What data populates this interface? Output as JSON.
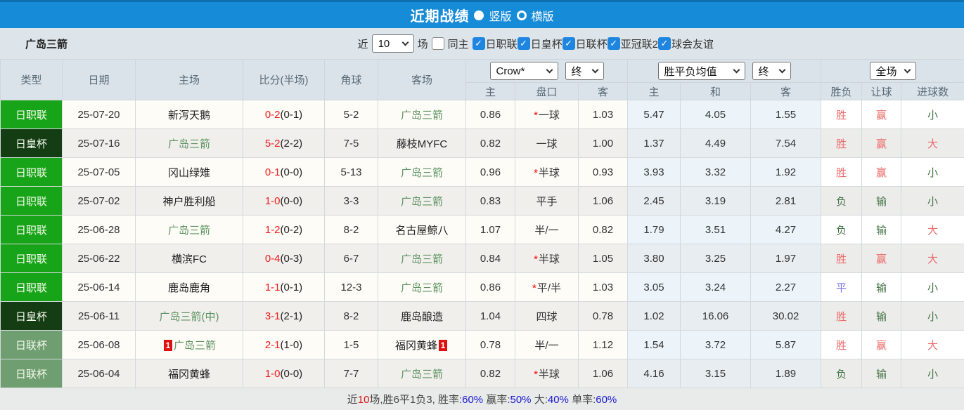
{
  "colors": {
    "title_bar_bg": "#168bd7",
    "team_green": "#5d9361",
    "score_red": "#f21c1c",
    "league": {
      "日职联": "#18a418",
      "日皇杯": "#143d14",
      "日联杯": "#6f9e70"
    },
    "result": {
      "red": "#ec6b6a",
      "green": "#477547",
      "blue": "#7575f0"
    },
    "summary": {
      "dark": "#444444",
      "red": "#dd1111",
      "blue": "#1919cf"
    }
  },
  "title_bar": {
    "title": "近期战绩",
    "options": [
      {
        "label": "竖版",
        "selected": true
      },
      {
        "label": "横版",
        "selected": false
      }
    ]
  },
  "filter_bar": {
    "team": "广岛三箭",
    "recent_prefix": "近",
    "recent_value": "10",
    "recent_suffix": "场",
    "same_home": {
      "label": "同主",
      "checked": false
    },
    "leagues": [
      {
        "label": "日职联",
        "checked": true
      },
      {
        "label": "日皇杯",
        "checked": true
      },
      {
        "label": "日联杯",
        "checked": true
      },
      {
        "label": "亚冠联2",
        "checked": true
      },
      {
        "label": "球会友谊",
        "checked": true
      }
    ]
  },
  "table": {
    "main_headers": [
      "类型",
      "日期",
      "主场",
      "比分(半场)",
      "角球",
      "客场"
    ],
    "selects": {
      "company": "Crow*",
      "company_time": "终",
      "avg": "胜平负均值",
      "avg_time": "终",
      "period": "全场"
    },
    "sub_headers": [
      "主",
      "盘口",
      "客",
      "主",
      "和",
      "客",
      "胜负",
      "让球",
      "进球数"
    ],
    "rows": [
      {
        "league": "日职联",
        "date": "25-07-20",
        "home": {
          "name": "新泻天鹅",
          "green": false
        },
        "score_ft": "0-2",
        "score_ht": "(0-1)",
        "corners": "5-2",
        "away": {
          "name": "广岛三箭",
          "green": true
        },
        "odds_home": "0.86",
        "handicap": "一球",
        "handicap_star": true,
        "odds_away": "1.03",
        "avg_home": "5.47",
        "avg_draw": "4.05",
        "avg_away": "1.55",
        "result_wdl": {
          "text": "胜",
          "color": "red"
        },
        "result_handicap": {
          "text": "赢",
          "color": "red"
        },
        "result_goals": {
          "text": "小",
          "color": "green"
        }
      },
      {
        "league": "日皇杯",
        "date": "25-07-16",
        "home": {
          "name": "广岛三箭",
          "green": true
        },
        "score_ft": "5-2",
        "score_ht": "(2-2)",
        "corners": "7-5",
        "away": {
          "name": "藤枝MYFC",
          "green": false
        },
        "odds_home": "0.82",
        "handicap": "一球",
        "handicap_star": false,
        "odds_away": "1.00",
        "avg_home": "1.37",
        "avg_draw": "4.49",
        "avg_away": "7.54",
        "result_wdl": {
          "text": "胜",
          "color": "red"
        },
        "result_handicap": {
          "text": "赢",
          "color": "red"
        },
        "result_goals": {
          "text": "大",
          "color": "red"
        }
      },
      {
        "league": "日职联",
        "date": "25-07-05",
        "home": {
          "name": "冈山绿雉",
          "green": false
        },
        "score_ft": "0-1",
        "score_ht": "(0-0)",
        "corners": "5-13",
        "away": {
          "name": "广岛三箭",
          "green": true
        },
        "odds_home": "0.96",
        "handicap": "半球",
        "handicap_star": true,
        "odds_away": "0.93",
        "avg_home": "3.93",
        "avg_draw": "3.32",
        "avg_away": "1.92",
        "result_wdl": {
          "text": "胜",
          "color": "red"
        },
        "result_handicap": {
          "text": "赢",
          "color": "red"
        },
        "result_goals": {
          "text": "小",
          "color": "green"
        }
      },
      {
        "league": "日职联",
        "date": "25-07-02",
        "home": {
          "name": "神户胜利船",
          "green": false
        },
        "score_ft": "1-0",
        "score_ht": "(0-0)",
        "corners": "3-3",
        "away": {
          "name": "广岛三箭",
          "green": true
        },
        "odds_home": "0.83",
        "handicap": "平手",
        "handicap_star": false,
        "odds_away": "1.06",
        "avg_home": "2.45",
        "avg_draw": "3.19",
        "avg_away": "2.81",
        "result_wdl": {
          "text": "负",
          "color": "green"
        },
        "result_handicap": {
          "text": "输",
          "color": "green"
        },
        "result_goals": {
          "text": "小",
          "color": "green"
        }
      },
      {
        "league": "日职联",
        "date": "25-06-28",
        "home": {
          "name": "广岛三箭",
          "green": true
        },
        "score_ft": "1-2",
        "score_ht": "(0-2)",
        "corners": "8-2",
        "away": {
          "name": "名古屋鲸八",
          "green": false
        },
        "odds_home": "1.07",
        "handicap": "半/一",
        "handicap_star": false,
        "odds_away": "0.82",
        "avg_home": "1.79",
        "avg_draw": "3.51",
        "avg_away": "4.27",
        "result_wdl": {
          "text": "负",
          "color": "green"
        },
        "result_handicap": {
          "text": "输",
          "color": "green"
        },
        "result_goals": {
          "text": "大",
          "color": "red"
        }
      },
      {
        "league": "日职联",
        "date": "25-06-22",
        "home": {
          "name": "横滨FC",
          "green": false
        },
        "score_ft": "0-4",
        "score_ht": "(0-3)",
        "corners": "6-7",
        "away": {
          "name": "广岛三箭",
          "green": true
        },
        "odds_home": "0.84",
        "handicap": "半球",
        "handicap_star": true,
        "odds_away": "1.05",
        "avg_home": "3.80",
        "avg_draw": "3.25",
        "avg_away": "1.97",
        "result_wdl": {
          "text": "胜",
          "color": "red"
        },
        "result_handicap": {
          "text": "赢",
          "color": "red"
        },
        "result_goals": {
          "text": "大",
          "color": "red"
        }
      },
      {
        "league": "日职联",
        "date": "25-06-14",
        "home": {
          "name": "鹿岛鹿角",
          "green": false
        },
        "score_ft": "1-1",
        "score_ht": "(0-1)",
        "corners": "12-3",
        "away": {
          "name": "广岛三箭",
          "green": true
        },
        "odds_home": "0.86",
        "handicap": "平/半",
        "handicap_star": true,
        "odds_away": "1.03",
        "avg_home": "3.05",
        "avg_draw": "3.24",
        "avg_away": "2.27",
        "result_wdl": {
          "text": "平",
          "color": "blue"
        },
        "result_handicap": {
          "text": "输",
          "color": "green"
        },
        "result_goals": {
          "text": "小",
          "color": "green"
        }
      },
      {
        "league": "日皇杯",
        "date": "25-06-11",
        "home": {
          "name": "广岛三箭(中)",
          "green": true
        },
        "score_ft": "3-1",
        "score_ht": "(2-1)",
        "corners": "8-2",
        "away": {
          "name": "鹿岛酿造",
          "green": false
        },
        "odds_home": "1.04",
        "handicap": "四球",
        "handicap_star": false,
        "odds_away": "0.78",
        "avg_home": "1.02",
        "avg_draw": "16.06",
        "avg_away": "30.02",
        "result_wdl": {
          "text": "胜",
          "color": "red"
        },
        "result_handicap": {
          "text": "输",
          "color": "green"
        },
        "result_goals": {
          "text": "小",
          "color": "green"
        }
      },
      {
        "league": "日联杯",
        "date": "25-06-08",
        "home": {
          "name": "广岛三箭",
          "green": true,
          "badge_before": "1"
        },
        "score_ft": "2-1",
        "score_ht": "(1-0)",
        "corners": "1-5",
        "away": {
          "name": "福冈黄蜂",
          "green": false,
          "badge_after": "1"
        },
        "odds_home": "0.78",
        "handicap": "半/一",
        "handicap_star": false,
        "odds_away": "1.12",
        "avg_home": "1.54",
        "avg_draw": "3.72",
        "avg_away": "5.87",
        "result_wdl": {
          "text": "胜",
          "color": "red"
        },
        "result_handicap": {
          "text": "赢",
          "color": "red"
        },
        "result_goals": {
          "text": "大",
          "color": "red"
        }
      },
      {
        "league": "日联杯",
        "date": "25-06-04",
        "home": {
          "name": "福冈黄蜂",
          "green": false
        },
        "score_ft": "1-0",
        "score_ht": "(0-0)",
        "corners": "7-7",
        "away": {
          "name": "广岛三箭",
          "green": true
        },
        "odds_home": "0.82",
        "handicap": "半球",
        "handicap_star": true,
        "odds_away": "1.06",
        "avg_home": "4.16",
        "avg_draw": "3.15",
        "avg_away": "1.89",
        "result_wdl": {
          "text": "负",
          "color": "green"
        },
        "result_handicap": {
          "text": "输",
          "color": "green"
        },
        "result_goals": {
          "text": "小",
          "color": "green"
        }
      }
    ]
  },
  "summary": {
    "segments": [
      {
        "text": "近",
        "color": "dark"
      },
      {
        "text": "10",
        "color": "red"
      },
      {
        "text": "场,胜6平1负3, 胜率:",
        "color": "dark"
      },
      {
        "text": "60%",
        "color": "blue"
      },
      {
        "text": " 赢率:",
        "color": "dark"
      },
      {
        "text": "50%",
        "color": "blue"
      },
      {
        "text": " 大:",
        "color": "dark"
      },
      {
        "text": "40%",
        "color": "blue"
      },
      {
        "text": " 单率:",
        "color": "dark"
      },
      {
        "text": "60%",
        "color": "blue"
      }
    ]
  }
}
